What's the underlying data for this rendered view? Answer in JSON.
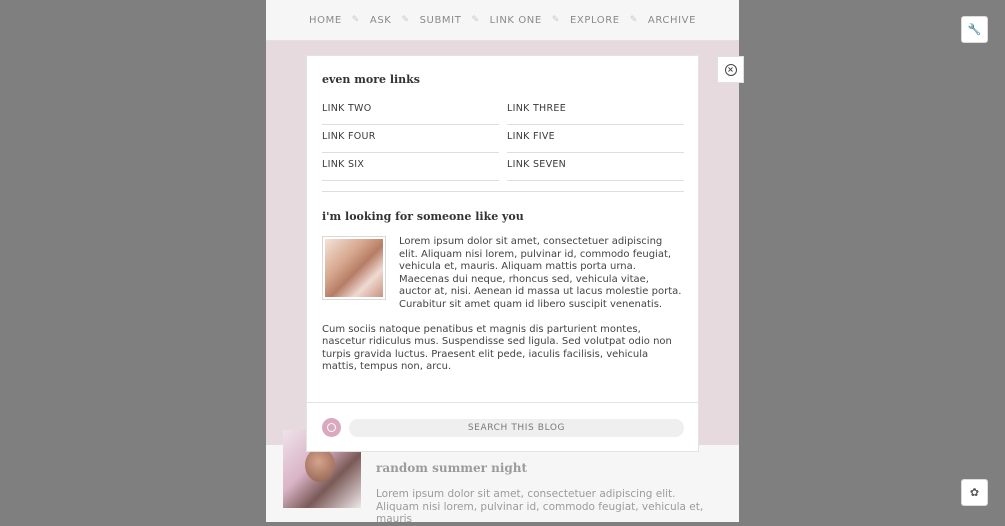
{
  "nav": {
    "items": [
      "HOME",
      "ASK",
      "SUBMIT",
      "LINK ONE",
      "EXPLORE",
      "ARCHIVE"
    ],
    "separator": "✎"
  },
  "popup": {
    "links_title": "even more links",
    "links": [
      "LINK TWO",
      "LINK THREE",
      "LINK FOUR",
      "LINK FIVE",
      "LINK SIX",
      "LINK SEVEN"
    ],
    "about_title": "i'm looking for someone like you",
    "about_p1": "Lorem ipsum dolor sit amet, consectetuer adipiscing elit. Aliquam nisi lorem, pulvinar id, commodo feugiat, vehicula et, mauris. Aliquam mattis porta urna. Maecenas dui neque, rhoncus sed, vehicula vitae, auctor at, nisi. Aenean id massa ut lacus molestie porta. Curabitur sit amet quam id libero suscipit venenatis.",
    "about_p2": "Cum sociis natoque penatibus et magnis dis parturient montes, nascetur ridiculus mus. Suspendisse sed ligula. Sed volutpat odio non turpis gravida luctus. Praesent elit pede, iaculis facilisis, vehicula mattis, tempus non, arcu.",
    "search_placeholder": "SEARCH THIS BLOG"
  },
  "post": {
    "title": "random summer night",
    "excerpt": "Lorem ipsum dolor sit amet, consectetuer adipiscing elit. Aliquam nisi lorem, pulvinar id, commodo feugiat, vehicula et, mauris"
  },
  "icons": {
    "close": "close-icon",
    "customize": "wrench-icon",
    "dashboard": "flower-icon",
    "search": "search-icon"
  },
  "colors": {
    "page_bg": "#7f7f7f",
    "blog_bg": "#e6dade",
    "accent": "#dba9be"
  }
}
